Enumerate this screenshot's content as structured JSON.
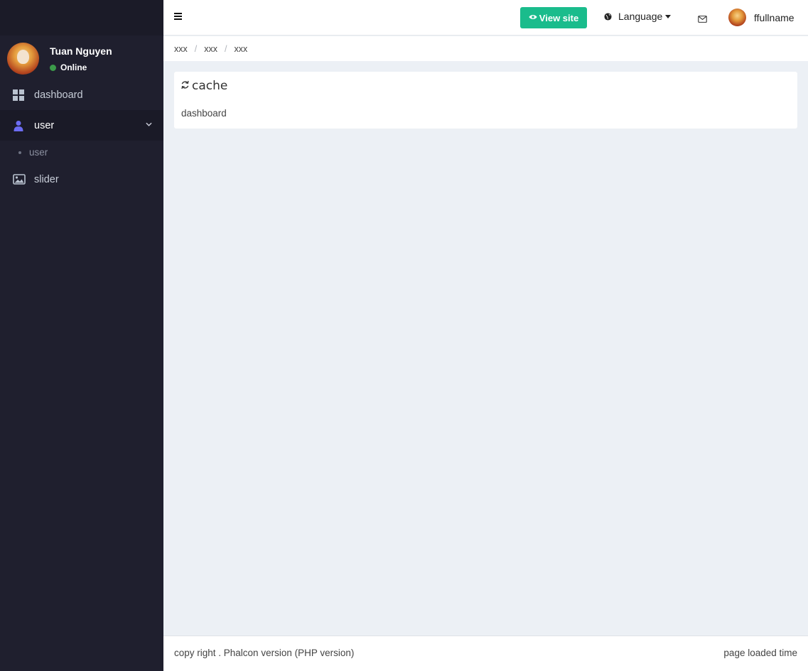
{
  "sidebar": {
    "user_name": "Tuan Nguyen",
    "status": "Online",
    "status_color": "#3c9b4a",
    "background": "#1f1f2e",
    "items": [
      {
        "label": "dashboard",
        "icon": "dashboard-grid-icon"
      },
      {
        "label": "user",
        "icon": "user-icon",
        "active": true,
        "expanded": true,
        "children": [
          {
            "label": "user"
          }
        ]
      },
      {
        "label": "slider",
        "icon": "image-icon"
      }
    ]
  },
  "header": {
    "view_site_label": "View site",
    "view_site_color": "#1abc8c",
    "language_label": "Language",
    "user_name": "ffullname"
  },
  "breadcrumb": [
    "xxx",
    "xxx",
    "xxx"
  ],
  "card": {
    "title": "cache",
    "body": "dashboard"
  },
  "footer": {
    "left": "copy right . Phalcon version (PHP version)",
    "right": "page loaded time"
  }
}
